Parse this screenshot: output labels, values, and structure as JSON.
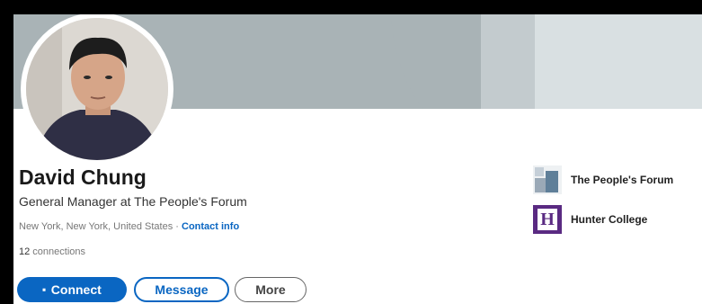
{
  "profile": {
    "name": "David Chung",
    "headline": "General Manager at The People's Forum",
    "location": "New York, New York, United States",
    "separator": " · ",
    "contact_info_label": "Contact info",
    "connections_count": "12",
    "connections_label": " connections"
  },
  "actions": {
    "connect_label": "Connect",
    "message_label": "Message",
    "more_label": "More"
  },
  "organizations": [
    {
      "name": "The People's Forum",
      "icon": "peoples-forum-logo"
    },
    {
      "name": "Hunter College",
      "icon": "hunter-college-logo",
      "logo_letter": "H"
    }
  ],
  "colors": {
    "primary": "#0a66c2",
    "hunter_purple": "#5a2a82"
  }
}
